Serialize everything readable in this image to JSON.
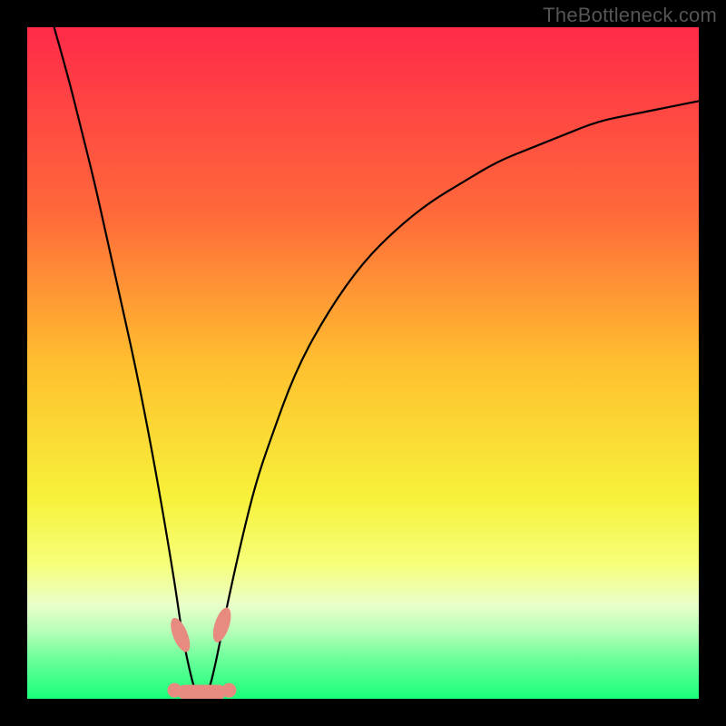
{
  "attribution": "TheBottleneck.com",
  "chart_data": {
    "type": "line",
    "title": "",
    "xlabel": "",
    "ylabel": "",
    "xlim": [
      0,
      100
    ],
    "ylim": [
      0,
      100
    ],
    "series": [
      {
        "name": "curve",
        "x": [
          4,
          6,
          8,
          10,
          12,
          14,
          16,
          18,
          20,
          22,
          23,
          24,
          25,
          26,
          27,
          28,
          29,
          30,
          32,
          34,
          36,
          40,
          45,
          50,
          55,
          60,
          65,
          70,
          75,
          80,
          85,
          90,
          95,
          100
        ],
        "values": [
          100,
          93,
          85,
          77,
          68,
          59,
          50,
          40,
          29,
          17,
          10,
          5,
          1,
          0,
          1,
          5,
          10,
          15,
          24,
          32,
          38,
          49,
          58,
          65,
          70,
          74,
          77,
          80,
          82,
          84,
          86,
          87,
          88,
          89
        ]
      }
    ],
    "markers": [
      {
        "name": "left-pill",
        "x": 22.8,
        "y": 9.5
      },
      {
        "name": "right-pill",
        "x": 29.0,
        "y": 11.0
      },
      {
        "name": "bottom-cluster",
        "x": 26.0,
        "y": 1.0
      }
    ],
    "gradient_stops": [
      {
        "offset": 0,
        "color": "#ff2a49"
      },
      {
        "offset": 28,
        "color": "#ff6a3a"
      },
      {
        "offset": 50,
        "color": "#ffbf2f"
      },
      {
        "offset": 70,
        "color": "#f7f13a"
      },
      {
        "offset": 80,
        "color": "#f6ff7a"
      },
      {
        "offset": 86,
        "color": "#eaffca"
      },
      {
        "offset": 90,
        "color": "#b6ffb8"
      },
      {
        "offset": 94,
        "color": "#6cff9a"
      },
      {
        "offset": 100,
        "color": "#1aff79"
      }
    ]
  }
}
